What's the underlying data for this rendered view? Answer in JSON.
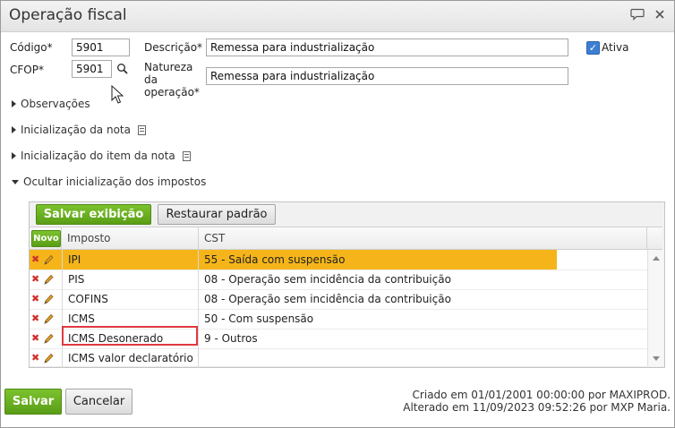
{
  "window": {
    "title": "Operação fiscal",
    "icons": [
      "speech-bubble-icon",
      "close-icon"
    ]
  },
  "form": {
    "codigo_label": "Código*",
    "codigo_value": "5901",
    "cfop_label": "CFOP*",
    "cfop_value": "5901",
    "descricao_label": "Descrição*",
    "descricao_value": "Remessa para industrialização",
    "natureza_label_1": "Natureza",
    "natureza_label_2": "da",
    "natureza_label_3": "operação*",
    "natureza_value": "Remessa para industrialização",
    "ativa_label": "Ativa",
    "ativa_checked": true
  },
  "sections": [
    {
      "label": "Observações",
      "expanded": false,
      "has_doc_icon": false
    },
    {
      "label": "Inicialização da nota",
      "expanded": false,
      "has_doc_icon": true
    },
    {
      "label": "Inicialização do item da nota",
      "expanded": false,
      "has_doc_icon": true
    },
    {
      "label": "Ocultar inicialização dos impostos",
      "expanded": true,
      "has_doc_icon": false
    }
  ],
  "toolbar": {
    "save_view": "Salvar exibição",
    "restore_default": "Restaurar padrão"
  },
  "grid": {
    "new_label": "Novo",
    "columns": [
      "Imposto",
      "CST"
    ],
    "rows": [
      {
        "imposto": "IPI",
        "cst": "55 - Saída com suspensão",
        "selected": true
      },
      {
        "imposto": "PIS",
        "cst": "08 - Operação sem incidência da contribuição",
        "selected": false
      },
      {
        "imposto": "COFINS",
        "cst": "08 - Operação sem incidência da contribuição",
        "selected": false
      },
      {
        "imposto": "ICMS",
        "cst": "50 - Com suspensão",
        "selected": false
      },
      {
        "imposto": "ICMS Desonerado",
        "cst": "9 - Outros",
        "selected": false
      },
      {
        "imposto": "ICMS valor declaratório",
        "cst": "",
        "selected": false
      }
    ]
  },
  "footer": {
    "save": "Salvar",
    "cancel": "Cancelar",
    "created": "Criado em 01/01/2001 00:00:00 por MAXIPROD.",
    "modified": "Alterado em 11/09/2023 09:52:26 por MXP Maria."
  },
  "colors": {
    "accent_green": "#6bb024",
    "selected_row": "#f5b51a",
    "highlight_border": "#e0393e",
    "checkbox_blue": "#3c7fd2"
  }
}
